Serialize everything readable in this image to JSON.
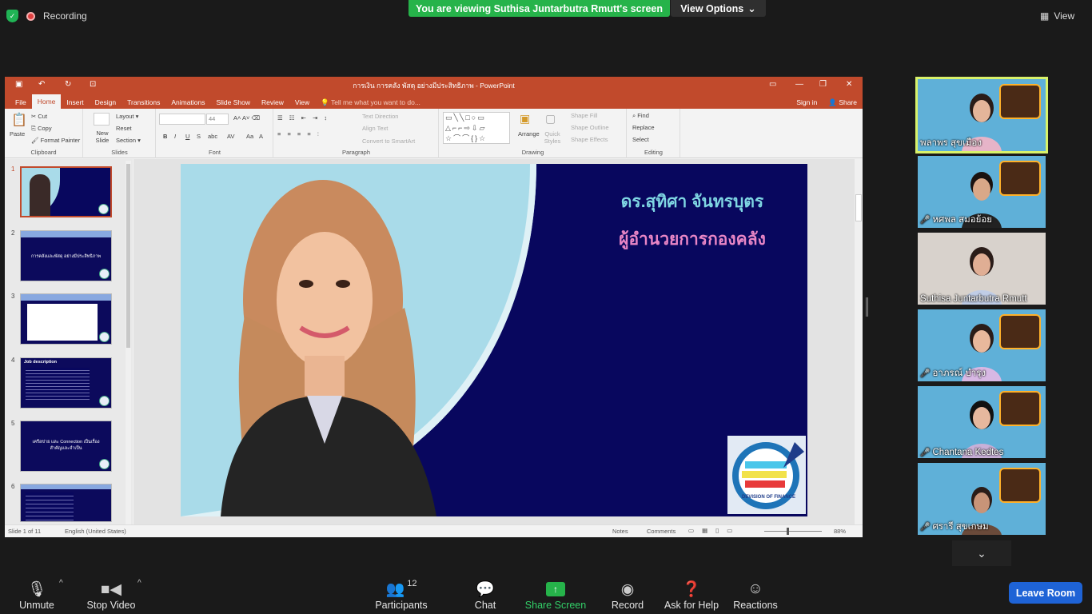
{
  "zoom_top": {
    "recording_label": "Recording",
    "viewing_text": "You are viewing Suthisa  Juntarbutra Rmutt's screen",
    "view_options_label": "View Options",
    "view_label": "View"
  },
  "ppt": {
    "window_title": "การเงิน การคลัง พัสดุ อย่างมีประสิทธิภาพ - PowerPoint",
    "menu": [
      "File",
      "Home",
      "Insert",
      "Design",
      "Transitions",
      "Animations",
      "Slide Show",
      "Review",
      "View"
    ],
    "active_menu": "Home",
    "tell_me": "Tell me what you want to do...",
    "sign_in": "Sign in",
    "share": "Share",
    "ribbon": {
      "clipboard": {
        "label": "Clipboard",
        "paste": "Paste",
        "cut": "Cut",
        "copy": "Copy",
        "format_painter": "Format Painter"
      },
      "slides": {
        "label": "Slides",
        "new_slide": "New Slide",
        "layout": "Layout",
        "reset": "Reset",
        "section": "Section"
      },
      "font": {
        "label": "Font",
        "size": "44"
      },
      "paragraph": {
        "label": "Paragraph",
        "text_direction": "Text Direction",
        "align_text": "Align Text",
        "convert_smartart": "Convert to SmartArt"
      },
      "drawing": {
        "label": "Drawing",
        "arrange": "Arrange",
        "quick_styles": "Quick Styles",
        "shape_fill": "Shape Fill",
        "shape_outline": "Shape Outline",
        "shape_effects": "Shape Effects"
      },
      "editing": {
        "label": "Editing",
        "find": "Find",
        "replace": "Replace",
        "select": "Select"
      }
    },
    "thumbnails": [
      {
        "num": "1",
        "text": ""
      },
      {
        "num": "2",
        "text": "การคลังและพัสดุ อย่างมีประสิทธิภาพ"
      },
      {
        "num": "3",
        "text": ""
      },
      {
        "num": "4",
        "text": "Job description"
      },
      {
        "num": "5",
        "text": "เครือข่าย และ Connection เป็นเรื่องสำคัญและจำเป็น"
      },
      {
        "num": "6",
        "text": ""
      }
    ],
    "slide": {
      "name_line1": "ดร.สุทิศา จันทรบุตร",
      "name_line2": "ผู้อำนวยการกองคลัง",
      "logo_text": "DEVISION OF FINANCE"
    },
    "status": {
      "slide_info": "Slide 1 of 11",
      "language": "English (United States)",
      "notes": "Notes",
      "comments": "Comments",
      "zoom": "88%"
    }
  },
  "participants_tiles": [
    {
      "name": "พลาพร สุขเมือง",
      "muted": false,
      "active": true
    },
    {
      "name": "หศพล สมอย้อย",
      "muted": true,
      "active": false
    },
    {
      "name": "Suthisa  Juntarbutra Rmutt",
      "muted": false,
      "active": false
    },
    {
      "name": "อาภรณ์ บำรุง",
      "muted": true,
      "active": false
    },
    {
      "name": "Chantana Kedtes",
      "muted": true,
      "active": false
    },
    {
      "name": "ศรารี สุขเกษม",
      "muted": true,
      "active": false
    }
  ],
  "toolbar": {
    "unmute": "Unmute",
    "stop_video": "Stop Video",
    "participants": "Participants",
    "participants_count": "12",
    "chat": "Chat",
    "share_screen": "Share Screen",
    "record": "Record",
    "ask_for_help": "Ask for Help",
    "reactions": "Reactions",
    "leave_room": "Leave Room"
  },
  "colors": {
    "ppt_accent": "#c14a2c",
    "slide_bg": "#08075e",
    "zoom_green": "#26b34a",
    "leave_blue": "#1e63d6"
  }
}
